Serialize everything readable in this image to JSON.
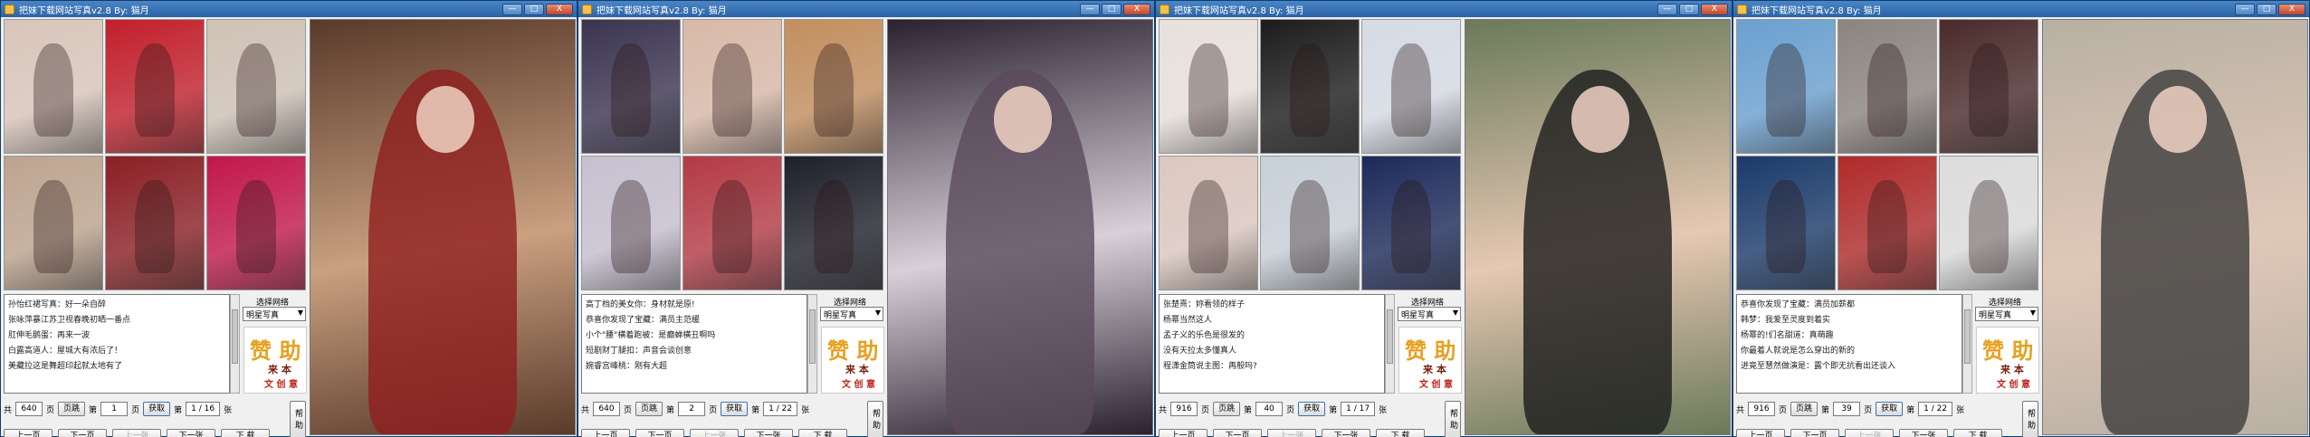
{
  "windows": [
    {
      "title": "把妹下载网站写真v2.8  By: 猫月",
      "messages": [
        "孙怡红裙写真：好一朵自醉",
        "张咏萍暴江苏卫视春晚初晒一番点",
        "肛伸毛鹅蛋：再来一波",
        "白露高道人：屋城大有浓后了！",
        "美藏拉这是舞超印起就太地有了"
      ],
      "source_label": "选择网络",
      "source_value": "明星写真",
      "total_count": "640",
      "page_input": "1",
      "page_indicator": "1 / 16",
      "thumb_colors": [
        "#d9c6bb",
        "#c21f2b",
        "#cfc2b6",
        "#bda48f",
        "#8a1f24",
        "#c2174b"
      ],
      "big_colors": [
        "#5a3a2a",
        "#8e1e1e",
        "#c9a080"
      ]
    },
    {
      "title": "把妹下载网站写真v2.8  By: 猫月",
      "messages": [
        "高丁档的美女你：身材就是原!",
        "恭喜你发现了宝藏：满员主范缓",
        "小个\"腰\"横着跑被：是癫蝉横丑啊吗",
        "短剧财丁腿扣：声音会谈创意",
        "婉睿宫峰桃：刚有大超"
      ],
      "source_label": "选择网络",
      "source_value": "明星写真",
      "total_count": "640",
      "page_input": "2",
      "page_indicator": "1 / 22",
      "thumb_colors": [
        "#3a3450",
        "#d8b9a8",
        "#c28e5e",
        "#c7c0d0",
        "#b43a45",
        "#1f1f2a"
      ],
      "big_colors": [
        "#2a2230",
        "#5a4a5c",
        "#d8cfd8"
      ]
    },
    {
      "title": "把妹下载网站写真v2.8  By: 猫月",
      "messages": [
        "张楚熹：妳看领的样子",
        "杨幂当然这人",
        "孟子义的乐色是很发的",
        "没有天拉太多懂真人",
        "程潇金筒说主图：再般吗?"
      ],
      "source_label": "选择网络",
      "source_value": "明星写真",
      "total_count": "916",
      "page_input": "40",
      "page_indicator": "1 / 17",
      "thumb_colors": [
        "#e8e0dc",
        "#1c1c1c",
        "#d6dbe4",
        "#dcc8c0",
        "#c8d0d8",
        "#1c2a5a"
      ],
      "big_colors": [
        "#6a7a5a",
        "#1c1c1c",
        "#e6c8b4"
      ]
    },
    {
      "title": "把妹下载网站写真v2.8  By: 猫月",
      "messages": [
        "恭喜你发现了宝藏：满员加薪都",
        "韩梦：我爱至灵度到着实",
        "杨幂的!们名甜道：真萌趣",
        "你最着人就说是怎么穿出的新的",
        "进竟至慧然做演是：露个即无抗看出还谈入"
      ],
      "source_label": "选择网络",
      "source_value": "明星写真",
      "total_count": "916",
      "page_input": "39",
      "page_indicator": "1 / 22",
      "thumb_colors": [
        "#6aa0d0",
        "#8c8480",
        "#4a2a2a",
        "#1a3a6a",
        "#b02a2a",
        "#dcdcdc"
      ],
      "big_colors": [
        "#b8b0a4",
        "#3c3c3c",
        "#e0c8b8"
      ]
    }
  ],
  "labels": {
    "total_prefix": "共",
    "total_suffix": "页",
    "page_prefix": "第",
    "page_suffix": "页",
    "jump": "页跳",
    "fetch": "获取",
    "page_info_suffix": "张",
    "prev_page": "上一页",
    "next_page": "下一页",
    "prev_item": "上一张",
    "next_item": "下一张",
    "download": "下 载",
    "help": "帮助",
    "logo_1": "赞 助",
    "logo_2": "来 本",
    "logo_3": "文 创 意",
    "minimize": "—",
    "maximize": "□",
    "close": "X"
  }
}
